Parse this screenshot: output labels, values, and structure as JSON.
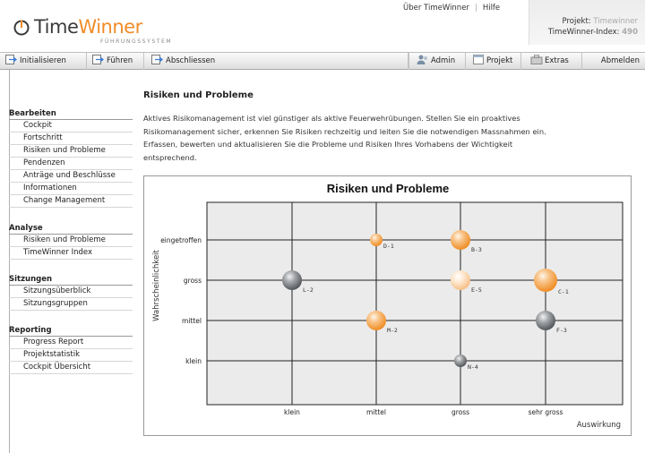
{
  "header": {
    "brand_part1": "Time",
    "brand_part2": "Winner",
    "subtitle": "FÜHRUNGSSYSTEM",
    "top_links": [
      "Über TimeWinner",
      "Hilfe"
    ],
    "project_label": "Projekt:",
    "project_value": "Timewinner",
    "index_label": "TimeWinner-Index:",
    "index_value": "490"
  },
  "toolbar": {
    "initialisieren": "Initialisieren",
    "fuehren": "Führen",
    "abschliessen": "Abschliessen",
    "admin": "Admin",
    "projekt": "Projekt",
    "extras": "Extras",
    "abmelden": "Abmelden"
  },
  "sidebar": {
    "sections": [
      {
        "title": "Bearbeiten",
        "items": [
          "Cockpit",
          "Fortschritt",
          "Risiken und Probleme",
          "Pendenzen",
          "Anträge und Beschlüsse",
          "Informationen",
          "Change Management"
        ]
      },
      {
        "title": "Analyse",
        "items": [
          "Risiken und Probleme",
          "TimeWinner Index"
        ]
      },
      {
        "title": "Sitzungen",
        "items": [
          "Sitzungsüberblick",
          "Sitzungsgruppen"
        ]
      },
      {
        "title": "Reporting",
        "items": [
          "Progress Report",
          "Projektstatistik",
          "Cockpit Übersicht"
        ]
      }
    ]
  },
  "main": {
    "title": "Risiken und Probleme",
    "intro": "Aktives Risikomanagement ist viel günstiger als aktive Feuerwehrübungen. Stellen Sie ein proaktives Risikomanagement sicher, erkennen Sie Risiken rechzeitig und leiten Sie die notwendigen Massnahmen ein. Erfassen, bewerten und aktualisieren Sie die Probleme und Risiken Ihres Vorhabens der Wichtigkeit entsprechend."
  },
  "colors": {
    "orange": "#f29b3a",
    "orange_light": "#f9c795",
    "orange_pale": "#fbd9b4",
    "grey": "#6e7276",
    "plot_bg": "#ebebeb"
  },
  "chart_data": {
    "type": "scatter",
    "title": "Risiken und Probleme",
    "xlabel": "Auswirkung",
    "ylabel": "Wahrscheinlichkeit",
    "x_categories": [
      "klein",
      "mittel",
      "gross",
      "sehr gross"
    ],
    "y_categories": [
      "klein",
      "mittel",
      "gross",
      "eingetroffen"
    ],
    "grid": true,
    "points": [
      {
        "label": "D-1",
        "x": "mittel",
        "y": "eingetroffen",
        "size": 1,
        "color": "orange"
      },
      {
        "label": "B-3",
        "x": "gross",
        "y": "eingetroffen",
        "size": 2,
        "color": "orange"
      },
      {
        "label": "L-2",
        "x": "klein",
        "y": "gross",
        "size": 2,
        "color": "grey"
      },
      {
        "label": "E-5",
        "x": "gross",
        "y": "gross",
        "size": 2,
        "color": "orange_pale"
      },
      {
        "label": "C-1",
        "x": "sehr gross",
        "y": "gross",
        "size": 3,
        "color": "orange"
      },
      {
        "label": "M-2",
        "x": "mittel",
        "y": "mittel",
        "size": 2,
        "color": "orange"
      },
      {
        "label": "F-3",
        "x": "sehr gross",
        "y": "mittel",
        "size": 2,
        "color": "grey"
      },
      {
        "label": "N-4",
        "x": "gross",
        "y": "klein",
        "size": 1,
        "color": "grey"
      }
    ]
  }
}
